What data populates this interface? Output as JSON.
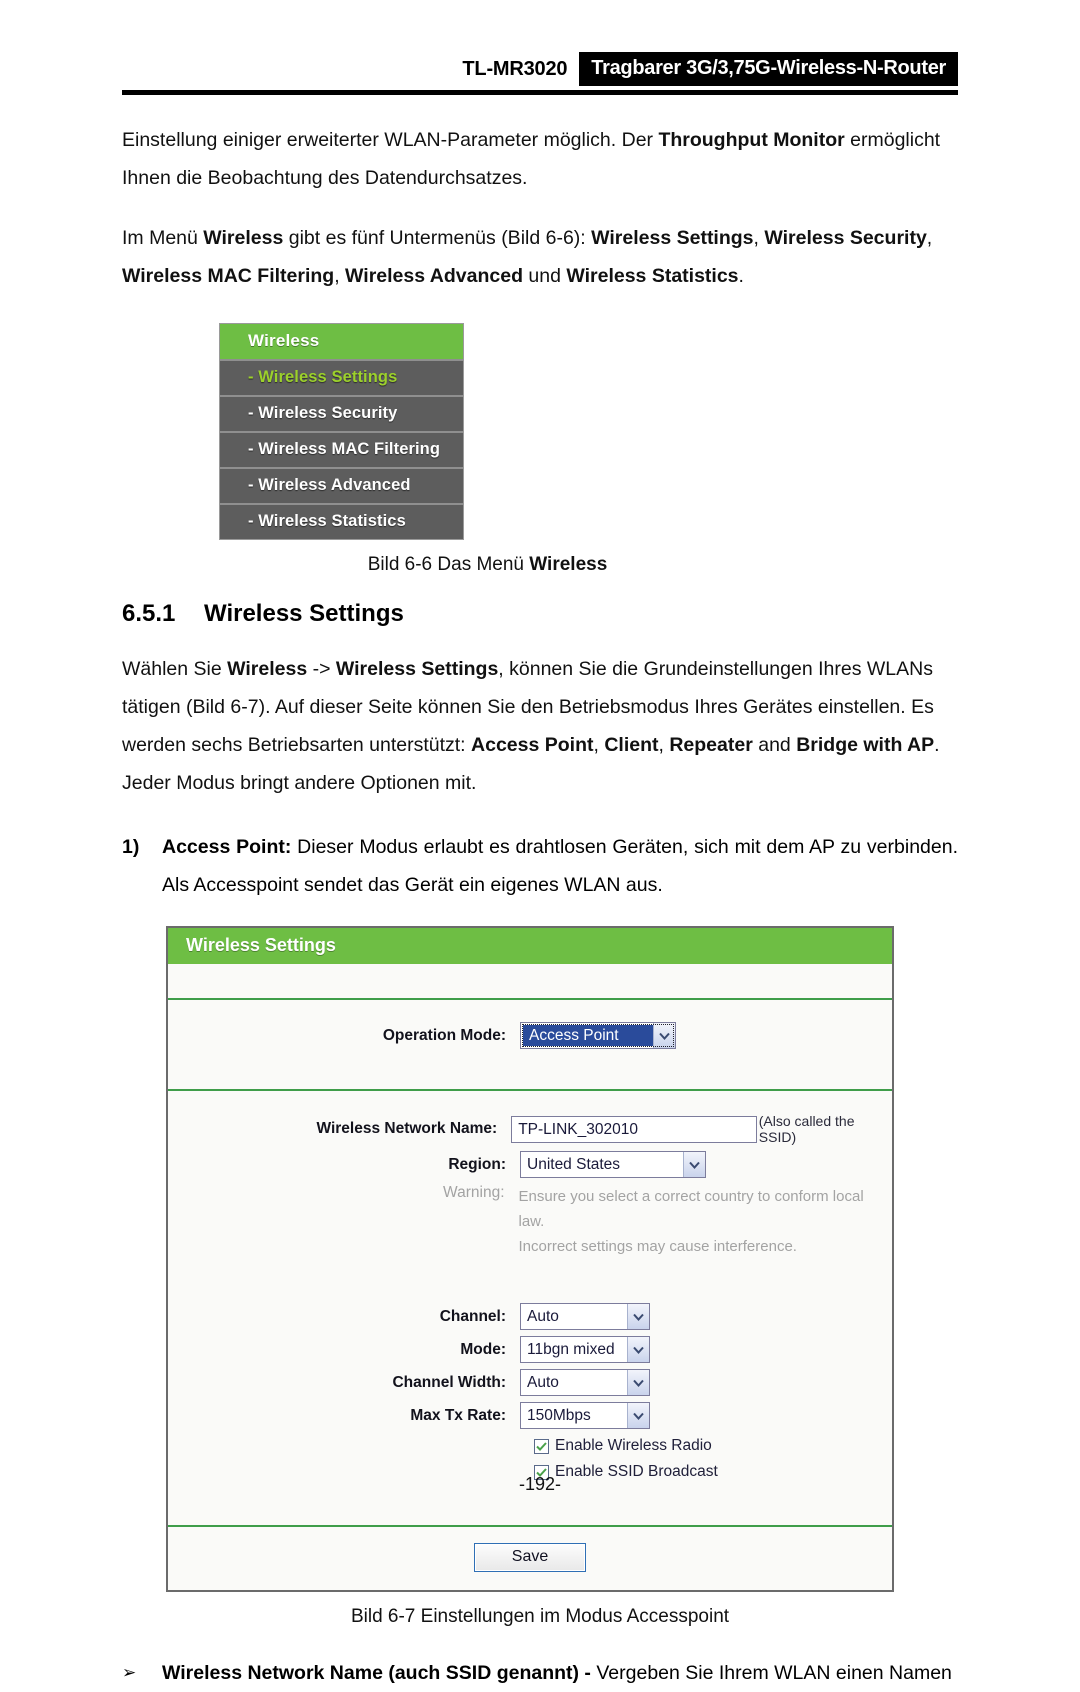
{
  "header": {
    "model": "TL-MR3020",
    "product": "Tragbarer 3G/3,75G-Wireless-N-Router"
  },
  "paragraphs": {
    "intro_part1": "Einstellung einiger erweiterter WLAN-Parameter möglich. Der ",
    "intro_bold1": "Throughput Monitor",
    "intro_part2": " ermöglicht Ihnen die Beobachtung des Datendurchsatzes.",
    "submenus_p1": "Im Menü ",
    "submenus_b1": "Wireless",
    "submenus_p2": " gibt es fünf Untermenüs (Bild 6-6): ",
    "submenus_b2": "Wireless Settings",
    "submenus_p3": ", ",
    "submenus_b3": "Wireless Security",
    "submenus_p4": ", ",
    "submenus_b4": "Wireless MAC Filtering",
    "submenus_p5": ", ",
    "submenus_b5": "Wireless Advanced",
    "submenus_p6": " und ",
    "submenus_b6": "Wireless Statistics",
    "submenus_p7": ".",
    "settings_p1": "Wählen Sie ",
    "settings_b1": "Wireless",
    "settings_p2": " -> ",
    "settings_b2": "Wireless Settings",
    "settings_p3": ", können Sie die Grundeinstellungen Ihres WLANs tätigen (Bild 6-7). Auf dieser Seite können Sie den Betriebsmodus Ihres Gerätes einstellen. Es werden sechs Betriebsarten unterstützt: ",
    "settings_b3": "Access Point",
    "settings_p4": ", ",
    "settings_b4": "Client",
    "settings_p5": ", ",
    "settings_b5": "Repeater",
    "settings_p6": " and ",
    "settings_b6": "Bridge with AP",
    "settings_p7": ". Jeder Modus bringt andere Optionen mit."
  },
  "list_items": {
    "ap_marker": "1)",
    "ap_bold": "Access Point:",
    "ap_text": " Dieser Modus erlaubt es drahtlosen Geräten, sich mit dem AP zu verbinden. Als Accesspoint sendet das Gerät ein eigenes WLAN aus.",
    "ssid_marker": "➢",
    "ssid_bold": "Wireless Network Name (auch SSID genannt) -",
    "ssid_text": " Vergeben Sie Ihrem WLAN einen Namen"
  },
  "wireless_menu": {
    "header_label": "Wireless",
    "items": [
      {
        "label": "- Wireless Settings",
        "active": true
      },
      {
        "label": "- Wireless Security",
        "active": false
      },
      {
        "label": "- Wireless MAC Filtering",
        "active": false
      },
      {
        "label": "- Wireless Advanced",
        "active": false
      },
      {
        "label": "- Wireless Statistics",
        "active": false
      }
    ]
  },
  "captions": {
    "fig_6_6_prefix": "Bild 6-6 Das Menü ",
    "fig_6_6_bold": "Wireless",
    "fig_6_7": "Bild 6-7 Einstellungen im Modus Accesspoint"
  },
  "section": {
    "number": "6.5.1",
    "title": "Wireless Settings"
  },
  "router_ui": {
    "title": "Wireless Settings",
    "operation_mode": {
      "label": "Operation Mode:",
      "value": "Access Point"
    },
    "network_name": {
      "label": "Wireless Network Name:",
      "value": "TP-LINK_302010",
      "hint": "(Also called the SSID)"
    },
    "region": {
      "label": "Region:",
      "value": "United States"
    },
    "warning": {
      "label": "Warning:",
      "line1": "Ensure you select a correct country to conform local law.",
      "line2": "Incorrect settings may cause interference."
    },
    "channel": {
      "label": "Channel:",
      "value": "Auto"
    },
    "mode": {
      "label": "Mode:",
      "value": "11bgn mixed"
    },
    "channel_width": {
      "label": "Channel Width:",
      "value": "Auto"
    },
    "max_tx_rate": {
      "label": "Max Tx Rate:",
      "value": "150Mbps"
    },
    "enable_radio": {
      "label": "Enable Wireless Radio",
      "checked": true
    },
    "enable_ssid_broadcast": {
      "label": "Enable SSID Broadcast",
      "checked": true
    },
    "save_label": "Save"
  },
  "footer": {
    "page_number": "-192-"
  },
  "colors": {
    "brand_green": "#6ebe44",
    "menu_gray": "#5d5d5d",
    "active_item_green": "#9cd12b",
    "select_highlight_blue": "#2a4b9b",
    "check_green": "#4aa14a"
  }
}
